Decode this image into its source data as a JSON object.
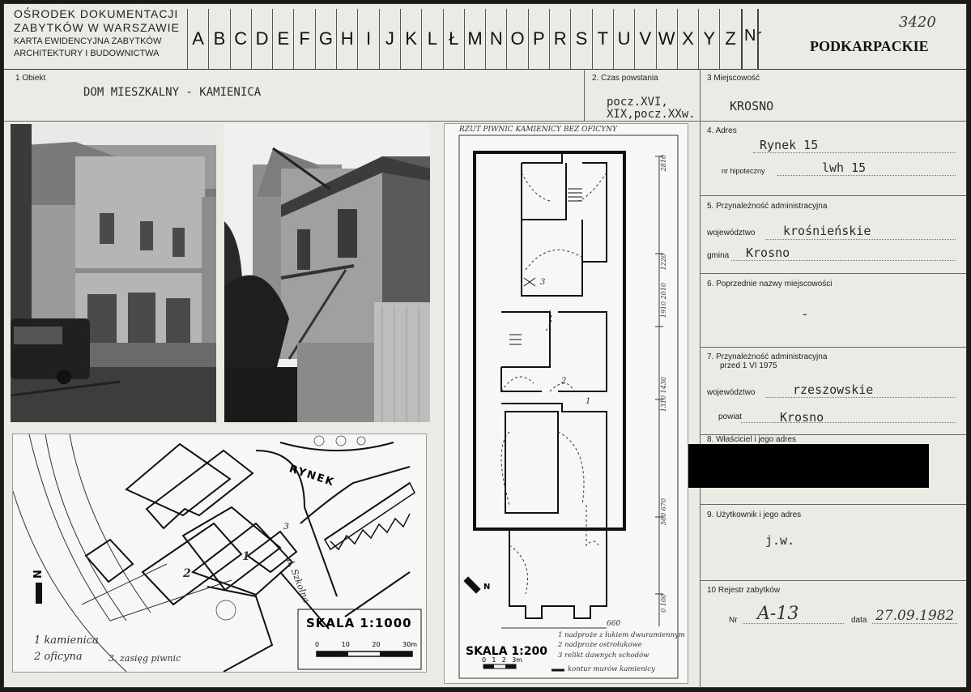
{
  "header": {
    "institution_line1": "OŚRODEK DOKUMENTACJI",
    "institution_line2": "ZABYTKÓW W WARSZAWIE",
    "card_type_line1": "KARTA EWIDENCYJNA ZABYTKÓW",
    "card_type_line2": "ARCHITEKTURY I BUDOWNICTWA",
    "letters": [
      "A",
      "B",
      "C",
      "D",
      "E",
      "F",
      "G",
      "H",
      "I",
      "J",
      "K",
      "L",
      "Ł",
      "M",
      "N",
      "O",
      "P",
      "R",
      "S",
      "T",
      "U",
      "V",
      "W",
      "X",
      "Y",
      "Z"
    ],
    "nr_label": "Nr",
    "nr_value": "3420",
    "region": "PODKARPACKIE"
  },
  "fields": {
    "object_label": "1 Obiekt",
    "object_value": "DOM MIESZKALNY - KAMIENICA",
    "period_label": "2. Czas powstania",
    "period_line1": "pocz.XVI,",
    "period_line2": "XIX,pocz.XXw.",
    "place_label": "3 Miejscowość",
    "place_value": "KROSNO",
    "address_label": "4. Adres",
    "address_value": "Rynek 15",
    "mortgage_label": "nr hipoteczny",
    "mortgage_value": "lwh 15",
    "admin_label": "5. Przynależność administracyjna",
    "voivodeship_label": "województwo",
    "voivodeship_value": "krośnieńskie",
    "commune_label": "gmina",
    "commune_value": "Krosno",
    "prev_names_label": "6. Poprzednie nazwy miejscowości",
    "prev_names_value": "-",
    "admin1975_label1": "7. Przynależność administracyjna",
    "admin1975_label2": "przed 1 VI 1975",
    "voivodeship1975_label": "województwo",
    "voivodeship1975_value": "rzeszowskie",
    "county_label": "powiat",
    "county_value": "Krosno",
    "owner_label": "8. Właściciel i jego adres",
    "user_label": "9. Użytkownik i jego adres",
    "user_value": "j.w.",
    "register_label": "10 Rejestr zabytków",
    "register_nr_label": "Nr",
    "register_nr_value": "A-13",
    "register_date_label": "data",
    "register_date_value": "27.09.1982"
  },
  "site_plan": {
    "street_rynek": "RYNEK",
    "street_szkolna": "ul. Szkolna",
    "north": "N",
    "scale_title": "SKALA 1:1000",
    "scale_ticks": [
      "0",
      "10",
      "20",
      "30m"
    ],
    "legend1": "1 kamienica",
    "legend2": "2 oficyna",
    "legend3": "3. zasięg piwnic",
    "bld1": "1",
    "bld2": "2",
    "bld3": "3"
  },
  "floor_plan": {
    "title": "RZUT PIWNIC KAMIENICY BEZ OFICYNY",
    "north": "N",
    "scale_title": "SKALA 1:200",
    "scale_ticks": [
      "0",
      "1",
      "2",
      "3m"
    ],
    "legend1": "1 nadproże z łukiem dwuramiennym",
    "legend2": "2 nadproże ostrołukowe",
    "legend3": "3 relikt dawnych schodów",
    "legend4": "kontur murów kamienicy",
    "dim_width": "660",
    "dims": [
      "2810",
      "1220",
      "1910 2010",
      "1310 1430",
      "560 670",
      "0 100"
    ],
    "marks": [
      "1",
      "2",
      "3",
      "4"
    ]
  }
}
